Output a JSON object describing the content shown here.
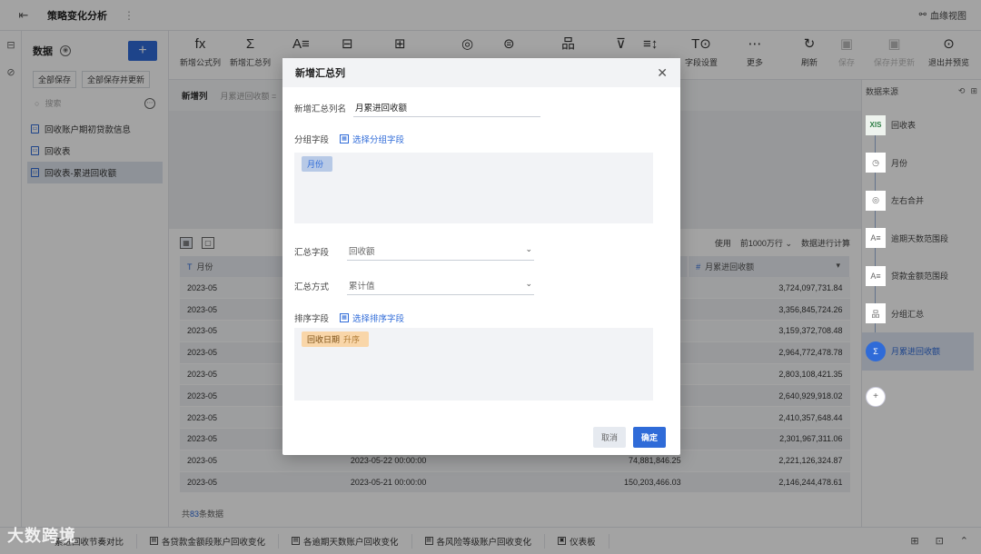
{
  "topbar": {
    "title": "策略变化分析",
    "more": "⋮",
    "lineage_label": "血缘视图"
  },
  "datapanel": {
    "title": "数据",
    "add": "+",
    "save_all": "全部保存",
    "save_all_update": "全部保存并更新",
    "search_placeholder": "搜索",
    "items": [
      {
        "label": "回收账户期初贷款信息"
      },
      {
        "label": "回收表"
      },
      {
        "label": "回收表-累进回收额"
      }
    ]
  },
  "toolbar": {
    "items": [
      {
        "label": "新增公式列",
        "icon": "fx"
      },
      {
        "label": "新增汇总列",
        "icon": "Σ"
      },
      {
        "label": "",
        "icon": "A≡"
      },
      {
        "label": "",
        "icon": "⊟"
      },
      {
        "label": "",
        "icon": "⊞"
      },
      {
        "label": "",
        "icon": "◎"
      },
      {
        "label": "",
        "icon": "⊜"
      },
      {
        "label": "",
        "icon": "品"
      },
      {
        "label": "",
        "icon": "⊽"
      },
      {
        "label": "",
        "icon": "≡↕"
      },
      {
        "label": "字段设置",
        "icon": "T⊙"
      },
      {
        "label": "更多",
        "icon": "⋯"
      },
      {
        "label": "刷新",
        "icon": "↻"
      },
      {
        "label": "保存",
        "icon": "▣"
      },
      {
        "label": "保存并更新",
        "icon": "▣"
      },
      {
        "label": "退出并预览",
        "icon": "⊙"
      }
    ]
  },
  "formula": {
    "key": "新增列",
    "value": "月累进回收额 ="
  },
  "table": {
    "row_limit_prefix": "使用",
    "row_limit": "前1000万行",
    "compute_label": "数据进行计算",
    "columns": [
      {
        "label": "月份",
        "type": "T"
      },
      {
        "label": "",
        "type": ""
      },
      {
        "label": "",
        "type": ""
      },
      {
        "label": "月累进回收额",
        "type": "#"
      }
    ],
    "rows": [
      [
        "2023-05",
        "",
        "",
        "3,724,097,731.84"
      ],
      [
        "2023-05",
        "",
        "",
        "3,356,845,724.26"
      ],
      [
        "2023-05",
        "",
        "",
        "3,159,372,708.48"
      ],
      [
        "2023-05",
        "",
        "",
        "2,964,772,478.78"
      ],
      [
        "2023-05",
        "",
        "",
        "2,803,108,421.35"
      ],
      [
        "2023-05",
        "",
        "",
        "2,640,929,918.02"
      ],
      [
        "2023-05",
        "",
        "",
        "2,410,357,648.44"
      ],
      [
        "2023-05",
        "",
        "",
        "2,301,967,311.06"
      ],
      [
        "2023-05",
        "2023-05-22 00:00:00",
        "74,881,846.25",
        "2,221,126,324.87"
      ],
      [
        "2023-05",
        "2023-05-21 00:00:00",
        "150,203,466.03",
        "2,146,244,478.61"
      ]
    ],
    "count_prefix": "共",
    "count": "83",
    "count_suffix": "条数据"
  },
  "rightpanel": {
    "title": "数据来源",
    "steps": [
      {
        "label": "回收表",
        "icon": "XIS"
      },
      {
        "label": "月份",
        "icon": "◷"
      },
      {
        "label": "左右合并",
        "icon": "◎"
      },
      {
        "label": "逾期天数范围段",
        "icon": "A≡"
      },
      {
        "label": "贷款金额范围段",
        "icon": "A≡"
      },
      {
        "label": "分组汇总",
        "icon": "品"
      },
      {
        "label": "月累进回收额",
        "icon": "Σ"
      }
    ]
  },
  "bottomtabs": {
    "items": [
      {
        "label": "累进回收节奏对比"
      },
      {
        "label": "各贷款金额段账户回收变化"
      },
      {
        "label": "各逾期天数账户回收变化"
      },
      {
        "label": "各风险等级账户回收变化"
      },
      {
        "label": "仪表板"
      }
    ],
    "watermark": "大数跨境"
  },
  "modal": {
    "title": "新增汇总列",
    "name_label": "新增汇总列名",
    "name_value": "月累进回收额",
    "group_label": "分组字段",
    "group_link": "选择分组字段",
    "group_chip": "月份",
    "agg_field_label": "汇总字段",
    "agg_field_value": "回收额",
    "agg_method_label": "汇总方式",
    "agg_method_value": "累计值",
    "sort_label": "排序字段",
    "sort_link": "选择排序字段",
    "sort_chip": "回收日期",
    "sort_order": "升序",
    "cancel": "取消",
    "ok": "确定"
  }
}
